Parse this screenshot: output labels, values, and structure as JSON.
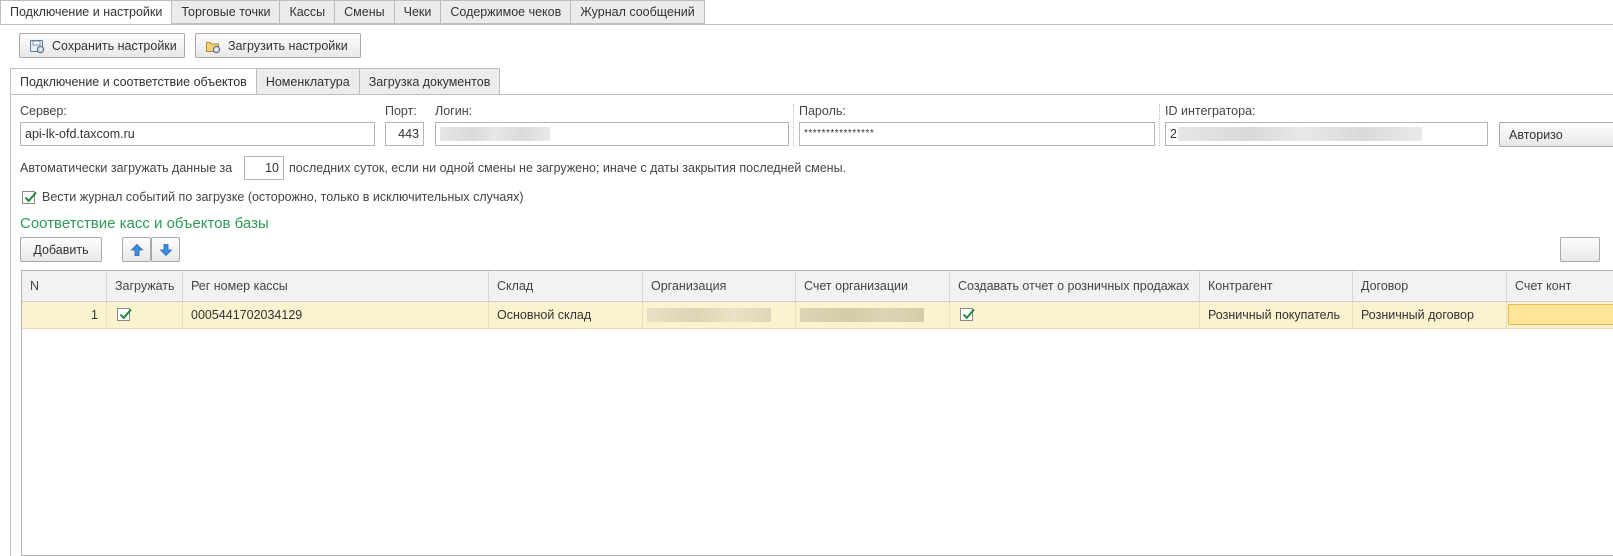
{
  "top_tabs": [
    {
      "label": "Подключение и настройки",
      "active": true
    },
    {
      "label": "Торговые точки",
      "active": false
    },
    {
      "label": "Кассы",
      "active": false
    },
    {
      "label": "Смены",
      "active": false
    },
    {
      "label": "Чеки",
      "active": false
    },
    {
      "label": "Содержимое чеков",
      "active": false
    },
    {
      "label": "Журнал сообщений",
      "active": false
    }
  ],
  "toolbar": {
    "save_label": "Сохранить настройки",
    "load_label": "Загрузить настройки"
  },
  "inner_tabs": [
    {
      "label": "Подключение и соответствие объектов",
      "active": true
    },
    {
      "label": "Номенклатура",
      "active": false
    },
    {
      "label": "Загрузка документов",
      "active": false
    }
  ],
  "connection": {
    "server_label": "Сервер:",
    "server_value": "api-lk-ofd.taxcom.ru",
    "port_label": "Порт:",
    "port_value": "443",
    "login_label": "Логин:",
    "password_label": "Пароль:",
    "password_value": "****************",
    "integrator_label": "ID интегратора:",
    "integrator_value_prefix": "2",
    "authorize_label": "Авторизо"
  },
  "autoload": {
    "prefix": "Автоматически загружать данные за",
    "days": "10",
    "suffix": "последних суток, если ни одной смены не загружено; иначе с даты закрытия последней смены."
  },
  "log": {
    "label": "Вести журнал событий по загрузке (осторожно, только в исключительных случаях)",
    "checked": true
  },
  "mapping": {
    "title": "Соответствие касс и объектов базы",
    "add_label": "Добавить"
  },
  "table": {
    "headers": [
      "N",
      "Загружать",
      "Рег номер кассы",
      "Склад",
      "Организация",
      "Счет организации",
      "Создавать отчет о розничных продажах",
      "Контрагент",
      "Договор",
      "Счет конт"
    ],
    "rows": [
      {
        "n": "1",
        "load": true,
        "reg": "0005441702034129",
        "warehouse": "Основной склад",
        "report": true,
        "counterparty": "Розничный покупатель",
        "contract": "Розничный договор"
      }
    ]
  },
  "colors": {
    "accent_green": "#2e9b54",
    "row_highlight": "#fbf3cf",
    "selected_cell": "#fde59a"
  }
}
